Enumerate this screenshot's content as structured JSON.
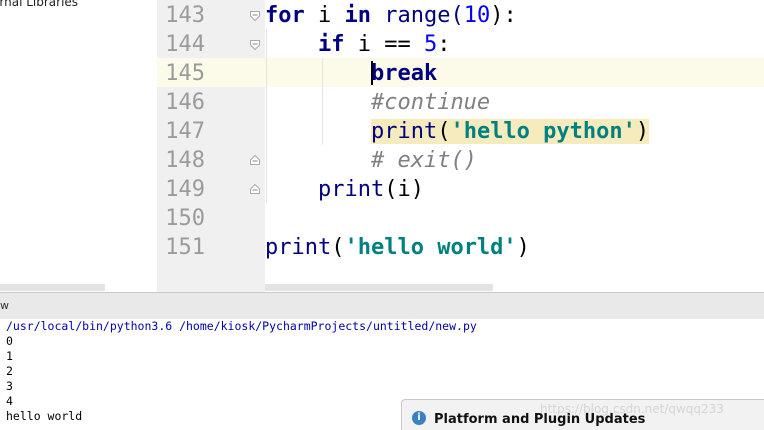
{
  "sidebar": {
    "item_label": "ernal Libraries"
  },
  "editor": {
    "line_numbers": [
      "143",
      "144",
      "145",
      "146",
      "147",
      "148",
      "149",
      "150",
      "151"
    ],
    "lines": {
      "l143": {
        "kw_for": "for",
        "var_i": " i ",
        "kw_in": "in",
        "fn_range": " range(",
        "num_10": "10",
        "tail": "):"
      },
      "l144": {
        "indent": "    ",
        "kw_if": "if",
        "mid": " i == ",
        "num_5": "5",
        "tail": ":"
      },
      "l145": {
        "indent": "        ",
        "kw_break": "break"
      },
      "l146": {
        "indent": "        ",
        "comment": "#continue"
      },
      "l147": {
        "indent": "        ",
        "fn_print": "print",
        "open": "(",
        "str": "'hello python'",
        "close": ")"
      },
      "l148": {
        "indent": "        ",
        "comment": "# exit()"
      },
      "l149": {
        "indent": "    ",
        "fn_print": "print",
        "args": "(i)"
      },
      "l151": {
        "fn_print": "print",
        "open": "(",
        "str": "'hello world'",
        "close": ")"
      }
    }
  },
  "run": {
    "title": "w",
    "console": [
      "/usr/local/bin/python3.6 /home/kiosk/PycharmProjects/untitled/new.py",
      "0",
      "1",
      "2",
      "3",
      "4",
      "hello world"
    ]
  },
  "notification": {
    "icon": "info-icon",
    "title": "Platform and Plugin Updates",
    "watermark": "https://blog.csdn.net/qwqq233"
  },
  "colors": {
    "keyword": "#000080",
    "number": "#0000ff",
    "string": "#008080",
    "comment": "#808080",
    "current_line": "#fcfae8",
    "gutter": "#f0f0f0"
  }
}
